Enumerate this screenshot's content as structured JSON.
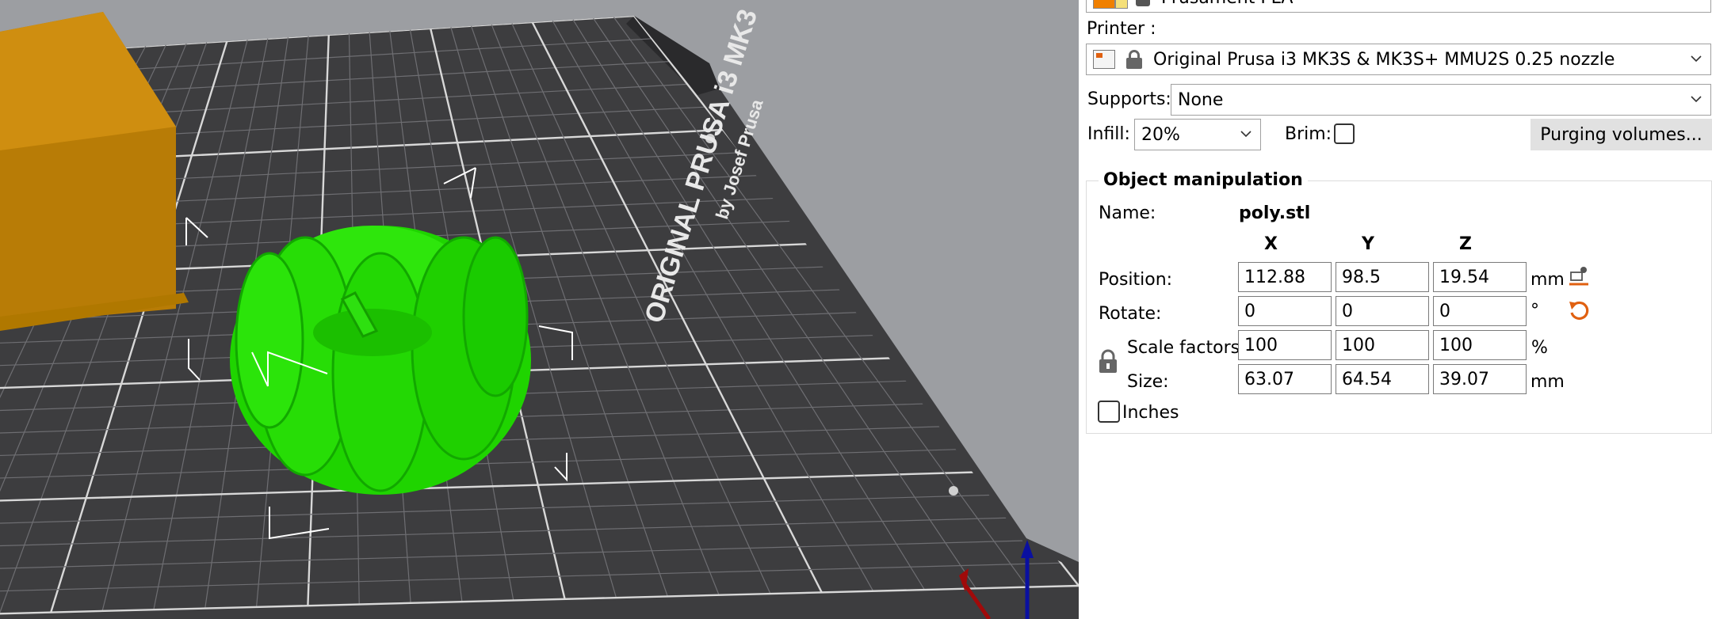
{
  "viewport": {
    "bed_text_line1": "ORIGINAL PRUSA i3 MK3",
    "bed_text_line2": "by Josef Prusa",
    "object_color": "#22dd00",
    "box_color": "#c98a10",
    "bed_color": "#3c3c3e"
  },
  "filament": {
    "label": "Prusament PLA",
    "swatch_colors": [
      "#f08000",
      "#f5e07a"
    ]
  },
  "printer": {
    "label": "Printer :",
    "value": "Original Prusa i3 MK3S & MK3S+ MMU2S 0.25 nozzle"
  },
  "supports": {
    "label": "Supports:",
    "value": "None"
  },
  "infill": {
    "label": "Infill:",
    "value": "20%"
  },
  "brim": {
    "label": "Brim:",
    "checked": false
  },
  "purging_button": "Purging volumes...",
  "object_manipulation": {
    "title": "Object manipulation",
    "name_label": "Name:",
    "name_value": "poly.stl",
    "headers": {
      "x": "X",
      "y": "Y",
      "z": "Z"
    },
    "position": {
      "label": "Position:",
      "x": "112.88",
      "y": "98.5",
      "z": "19.54",
      "unit": "mm"
    },
    "rotate": {
      "label": "Rotate:",
      "x": "0",
      "y": "0",
      "z": "0",
      "unit": "°"
    },
    "scale": {
      "label": "Scale factors:",
      "x": "100",
      "y": "100",
      "z": "100",
      "unit": "%"
    },
    "size": {
      "label": "Size:",
      "x": "63.07",
      "y": "64.54",
      "z": "39.07",
      "unit": "mm"
    },
    "inches_label": "Inches"
  },
  "accent_color": "#e06010"
}
